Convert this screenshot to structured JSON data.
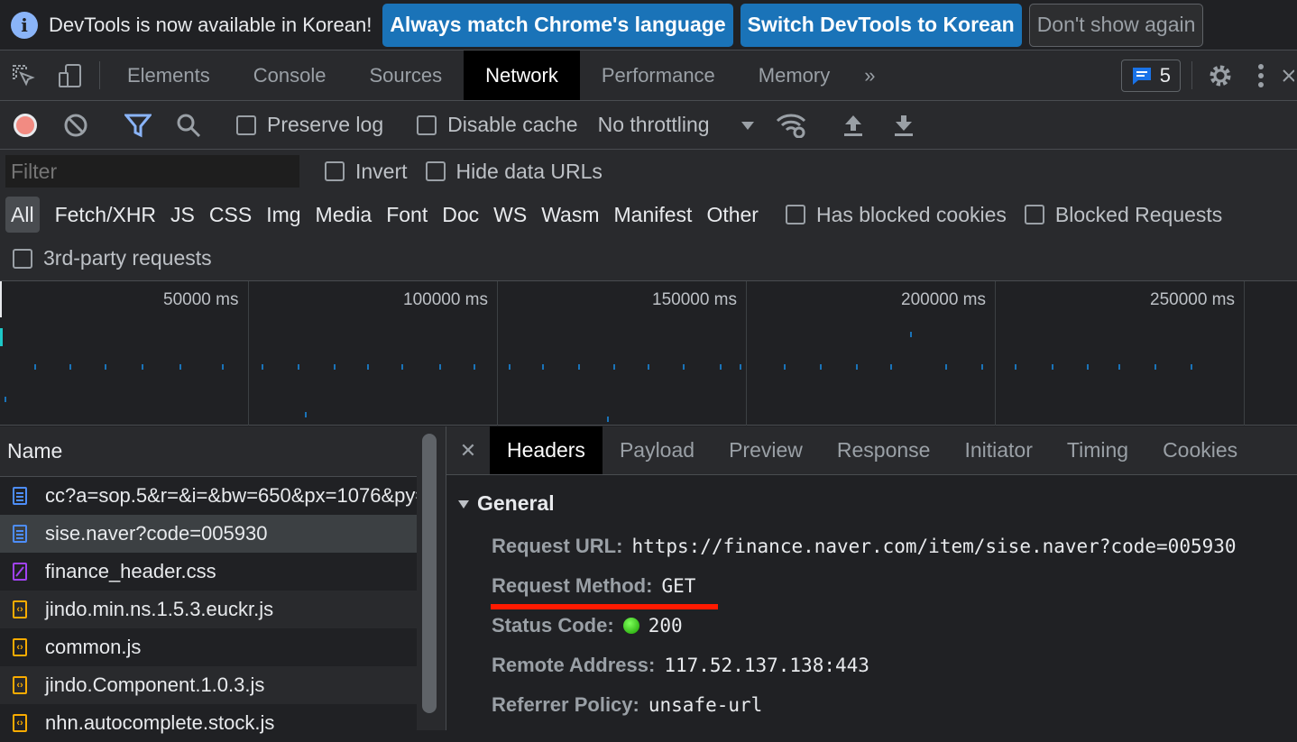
{
  "infobar": {
    "message": "DevTools is now available in Korean!",
    "btn_match": "Always match Chrome's language",
    "btn_switch": "Switch DevTools to Korean",
    "btn_dismiss": "Don't show again"
  },
  "tabs": {
    "elements": "Elements",
    "console": "Console",
    "sources": "Sources",
    "network": "Network",
    "performance": "Performance",
    "memory": "Memory",
    "more": "»",
    "issues_count": "5"
  },
  "toolbar": {
    "preserve_log": "Preserve log",
    "disable_cache": "Disable cache",
    "throttling": "No throttling"
  },
  "filter": {
    "placeholder": "Filter",
    "invert": "Invert",
    "hide_data_urls": "Hide data URLs"
  },
  "types": [
    "All",
    "Fetch/XHR",
    "JS",
    "CSS",
    "Img",
    "Media",
    "Font",
    "Doc",
    "WS",
    "Wasm",
    "Manifest",
    "Other"
  ],
  "type_checks": {
    "blocked_cookies": "Has blocked cookies",
    "blocked_requests": "Blocked Requests",
    "third_party": "3rd-party requests"
  },
  "timeline": {
    "labels": [
      "50000 ms",
      "100000 ms",
      "150000 ms",
      "200000 ms",
      "250000 ms"
    ]
  },
  "requests": {
    "header": "Name",
    "items": [
      {
        "name": "cc?a=sop.5&r=&i=&bw=650&px=1076&py=...",
        "type": "doc"
      },
      {
        "name": "sise.naver?code=005930",
        "type": "doc"
      },
      {
        "name": "finance_header.css",
        "type": "css"
      },
      {
        "name": "jindo.min.ns.1.5.3.euckr.js",
        "type": "js"
      },
      {
        "name": "common.js",
        "type": "js"
      },
      {
        "name": "jindo.Component.1.0.3.js",
        "type": "js"
      },
      {
        "name": "nhn.autocomplete.stock.js",
        "type": "js"
      }
    ]
  },
  "detail": {
    "tabs": [
      "Headers",
      "Payload",
      "Preview",
      "Response",
      "Initiator",
      "Timing",
      "Cookies"
    ],
    "section": "General",
    "rows": {
      "url_key": "Request URL:",
      "url_val": "https://finance.naver.com/item/sise.naver?code=005930",
      "method_key": "Request Method:",
      "method_val": "GET",
      "status_key": "Status Code:",
      "status_val": "200",
      "remote_key": "Remote Address:",
      "remote_val": "117.52.137.138:443",
      "referrer_key": "Referrer Policy:",
      "referrer_val": "unsafe-url"
    }
  },
  "colors": {
    "accent": "#1a73b8",
    "highlight_underline": "#ff1a00",
    "status_ok": "#1a9e00"
  }
}
